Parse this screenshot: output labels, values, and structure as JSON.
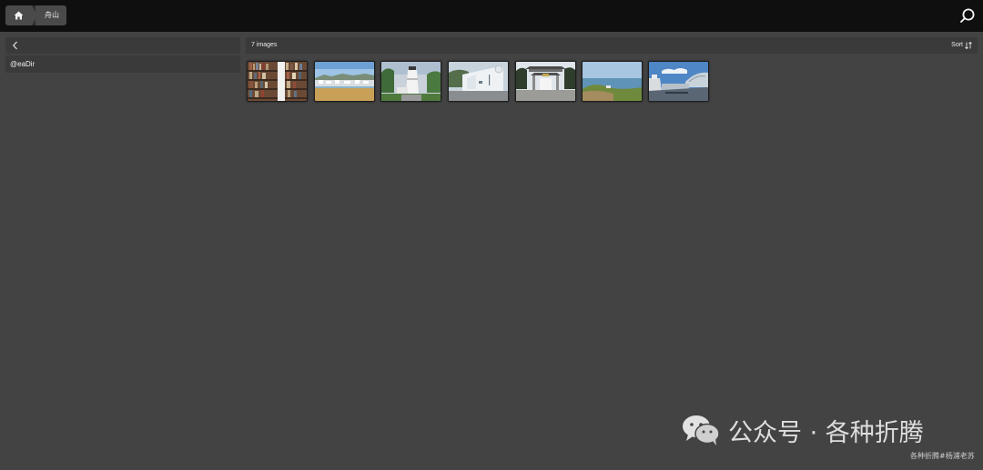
{
  "breadcrumb": {
    "home_icon": "home-icon",
    "current": "舟山"
  },
  "header": {
    "search_icon": "search-icon"
  },
  "sidebar": {
    "back_icon": "chevron-left-icon",
    "items": [
      {
        "label": "@eaDir"
      }
    ]
  },
  "gallery": {
    "count_label": "7 images",
    "sort_label": "Sort",
    "sort_icon": "sort-arrows-icon",
    "thumbnails": [
      {
        "subject": "bookshelf"
      },
      {
        "subject": "harbor-beach"
      },
      {
        "subject": "lighthouse"
      },
      {
        "subject": "museum-building"
      },
      {
        "subject": "temple-gate"
      },
      {
        "subject": "seaside-rocks"
      },
      {
        "subject": "ships-port"
      }
    ]
  },
  "watermark": {
    "main": "公众号 · 各种折腾",
    "sub": "各种折腾#杨浦老苏",
    "icon": "wechat-icon"
  },
  "colors": {
    "topbar": "#0f0f0f",
    "background": "#434343",
    "panel": "#3a3a3a",
    "crumb": "#4a4a4a"
  }
}
